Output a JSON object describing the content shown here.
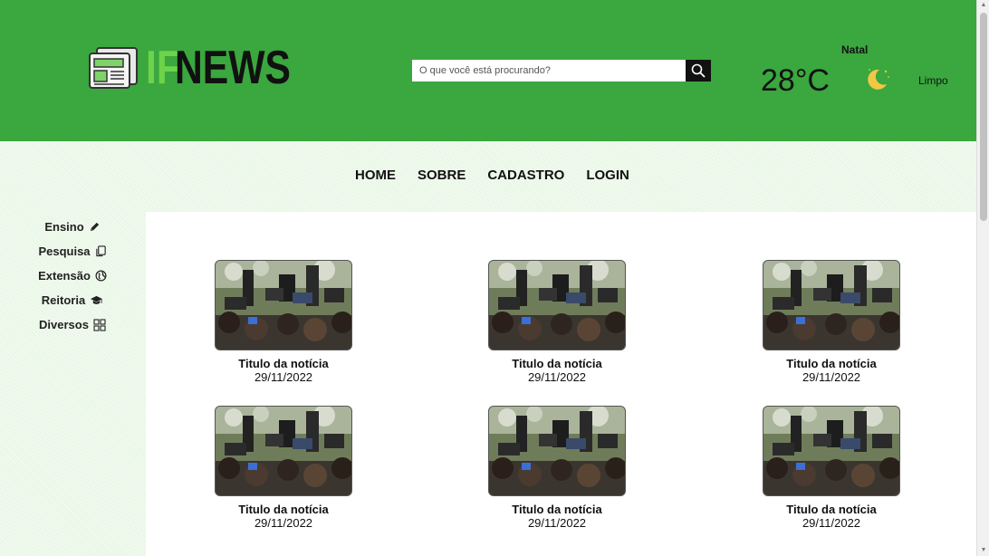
{
  "brand": {
    "if": "IF",
    "news": "NEWS",
    "accent": "#6cd34a",
    "header_bg": "#3aa73f"
  },
  "search": {
    "placeholder": "O que você está procurando?",
    "icon": "search-icon"
  },
  "weather": {
    "city": "Natal",
    "temperature": "28°C",
    "condition": "Limpo",
    "icon": "moon-icon"
  },
  "nav": {
    "items": [
      {
        "label": "HOME"
      },
      {
        "label": "SOBRE"
      },
      {
        "label": "CADASTRO"
      },
      {
        "label": "LOGIN"
      }
    ]
  },
  "sidebar": {
    "items": [
      {
        "label": "Ensino",
        "icon": "pencil-icon"
      },
      {
        "label": "Pesquisa",
        "icon": "copy-icon"
      },
      {
        "label": "Extensão",
        "icon": "globe-icon"
      },
      {
        "label": "Reitoria",
        "icon": "graduation-cap-icon"
      },
      {
        "label": "Diversos",
        "icon": "grid-icon"
      }
    ]
  },
  "news": {
    "cards": [
      {
        "title": "Titulo da notícia",
        "date": "29/11/2022"
      },
      {
        "title": "Titulo da notícia",
        "date": "29/11/2022"
      },
      {
        "title": "Titulo da notícia",
        "date": "29/11/2022"
      },
      {
        "title": "Titulo da notícia",
        "date": "29/11/2022"
      },
      {
        "title": "Titulo da notícia",
        "date": "29/11/2022"
      },
      {
        "title": "Titulo da notícia",
        "date": "29/11/2022"
      }
    ]
  }
}
